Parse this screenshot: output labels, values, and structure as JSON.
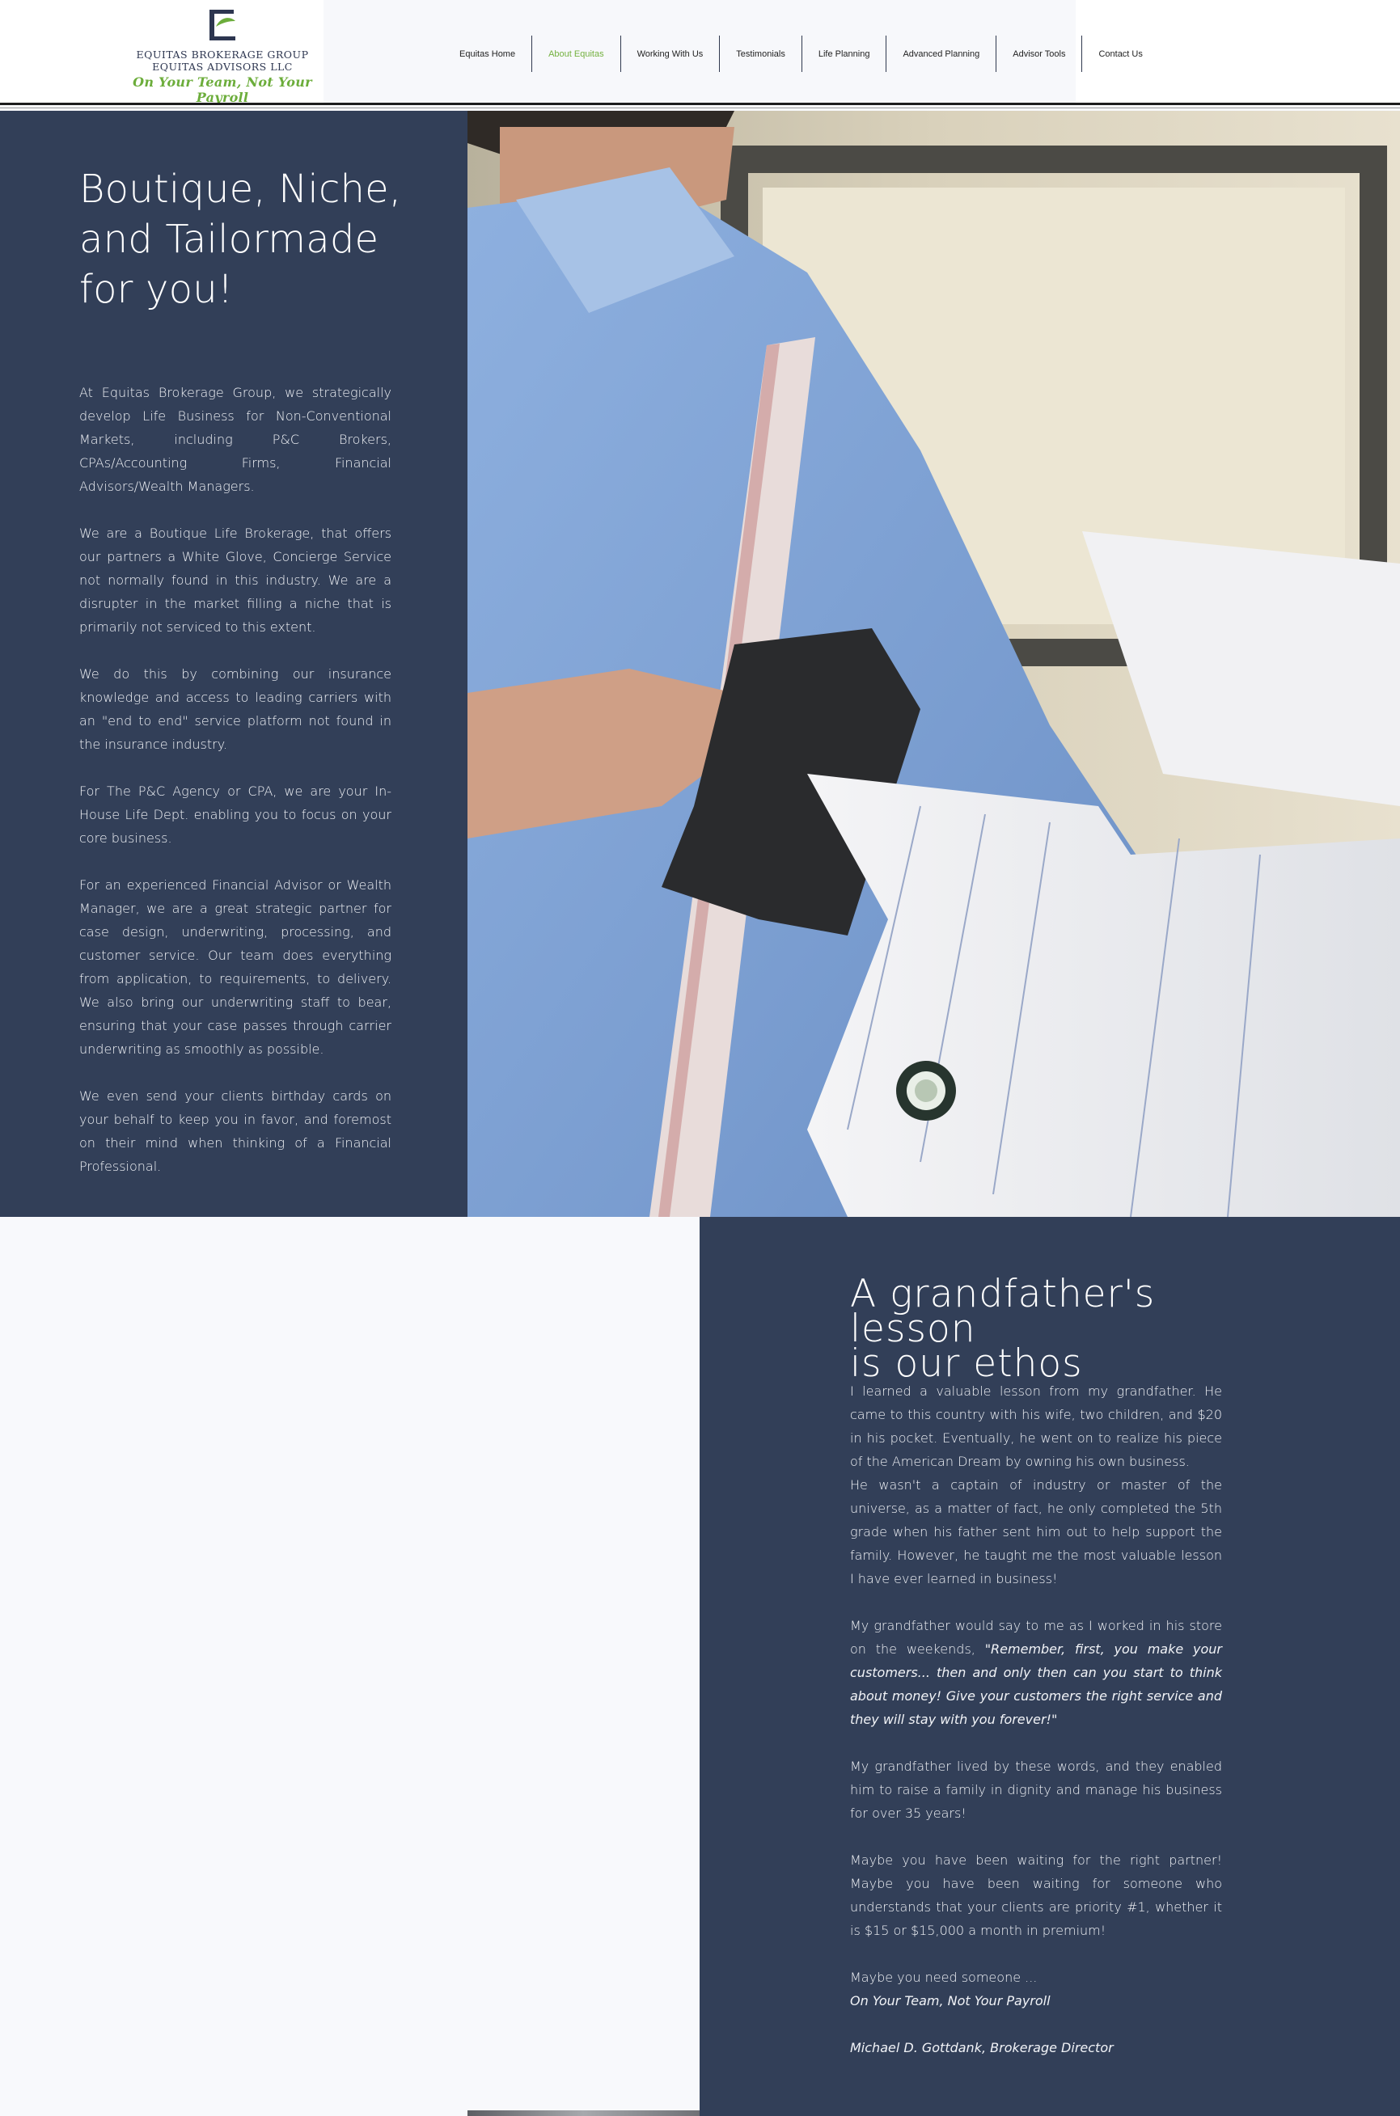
{
  "header": {
    "logo": {
      "letter": "E",
      "name_line1": "EQUITAS BROKERAGE GROUP",
      "name_line2": "EQUITAS ADVISORS LLC",
      "tagline": "On Your Team, Not Your Payroll"
    },
    "nav": [
      {
        "label": "Equitas Home"
      },
      {
        "label": "About Equitas",
        "active": true
      },
      {
        "label": "Working With Us"
      },
      {
        "label": "Testimonials"
      },
      {
        "label": "Life Planning"
      },
      {
        "label": "Advanced Planning"
      },
      {
        "label": "Advisor Tools"
      },
      {
        "label": "Contact Us"
      }
    ]
  },
  "intro": {
    "title": "Boutique, Niche,\nand Tailormade\nfor you!",
    "paragraphs": [
      "At Equitas Brokerage Group, we strategically develop Life Business for Non-Conventional Markets, including P&C Brokers, CPAs/Accounting Firms, Financial Advisors/Wealth Managers.",
      "We are a Boutique Life Brokerage, that offers our partners a White Glove, Concierge Service not normally found in this industry. We are a disrupter in the market filling a niche that is primarily not serviced to this extent.",
      "We do this by combining our insurance knowledge and access to leading carriers with an \"end to end\" service platform not found in the insurance industry.",
      "For The P&C Agency or CPA, we are your In-House Life Dept. enabling you to focus on your core business.",
      "For an experienced Financial Advisor or Wealth Manager, we are a great strategic partner for case design, underwriting, processing, and customer service. Our team does everything from application, to requirements, to delivery. We also bring our underwriting staff to bear, ensuring that your case passes through carrier underwriting as smoothly as possible.",
      "We even send your clients birthday cards on your behalf to keep you in favor, and foremost on their mind when thinking of a Financial Professional."
    ]
  },
  "ethos": {
    "title": "A grandfather's lesson\nis our ethos",
    "p1": "I learned a valuable lesson from my grandfather. He came to this country with his wife, two children, and $20 in his pocket. Eventually, he went on to realize his piece of the American Dream by owning his own business.",
    "p2": "He wasn't a captain of industry or master of the universe,  as a matter of fact, he only completed the 5th grade when his father sent him out to help support the family. However, he taught me the most valuable lesson I have ever learned in business!",
    "p3_lead": "My grandfather would say to me as I worked in his store on the weekends, ",
    "p3_quote": "\"Remember, first, you make your customers... then and only then can you start to think about money! Give your customers the right service and they will stay with you forever!\"",
    "p4": "My grandfather lived by these words, and they enabled him to raise a family in dignity and manage his business for over 35 years!",
    "p5": "Maybe you have been waiting for the right partner! Maybe you have been waiting for someone who understands that your clients are priority #1, whether it is $15 or $15,000 a month in premium!",
    "p6": "Maybe you need someone ...",
    "tagline": "On Your Team, Not Your Payroll",
    "signature": "Michael D. Gottdank, Brokerage Director"
  },
  "colors": {
    "navy_panel": "#323f58",
    "accent_green": "#74b13f",
    "page_background": "#f8f9fc"
  },
  "images": {
    "hero_photo": "tailor-measuring-shirt-sleeve-photo"
  }
}
